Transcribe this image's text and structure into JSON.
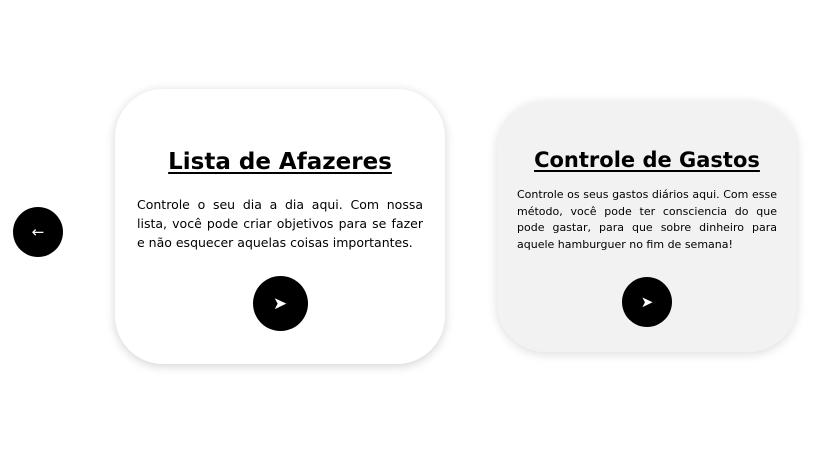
{
  "nav": {
    "back_glyph": "←"
  },
  "cards": [
    {
      "title": "Lista de Afazeres",
      "text": "Controle o seu dia a dia aqui. Com nossa lista, você pode criar objetivos para se fazer e não esquecer aquelas coisas importantes.",
      "button_glyph": "➤"
    },
    {
      "title": "Controle de Gastos",
      "text": "Controle os seus gastos diários aqui. Com esse método, você pode ter consciencia do que pode gastar, para que sobre dinheiro para aquele hamburguer no fim de semana!",
      "button_glyph": "➤"
    }
  ]
}
